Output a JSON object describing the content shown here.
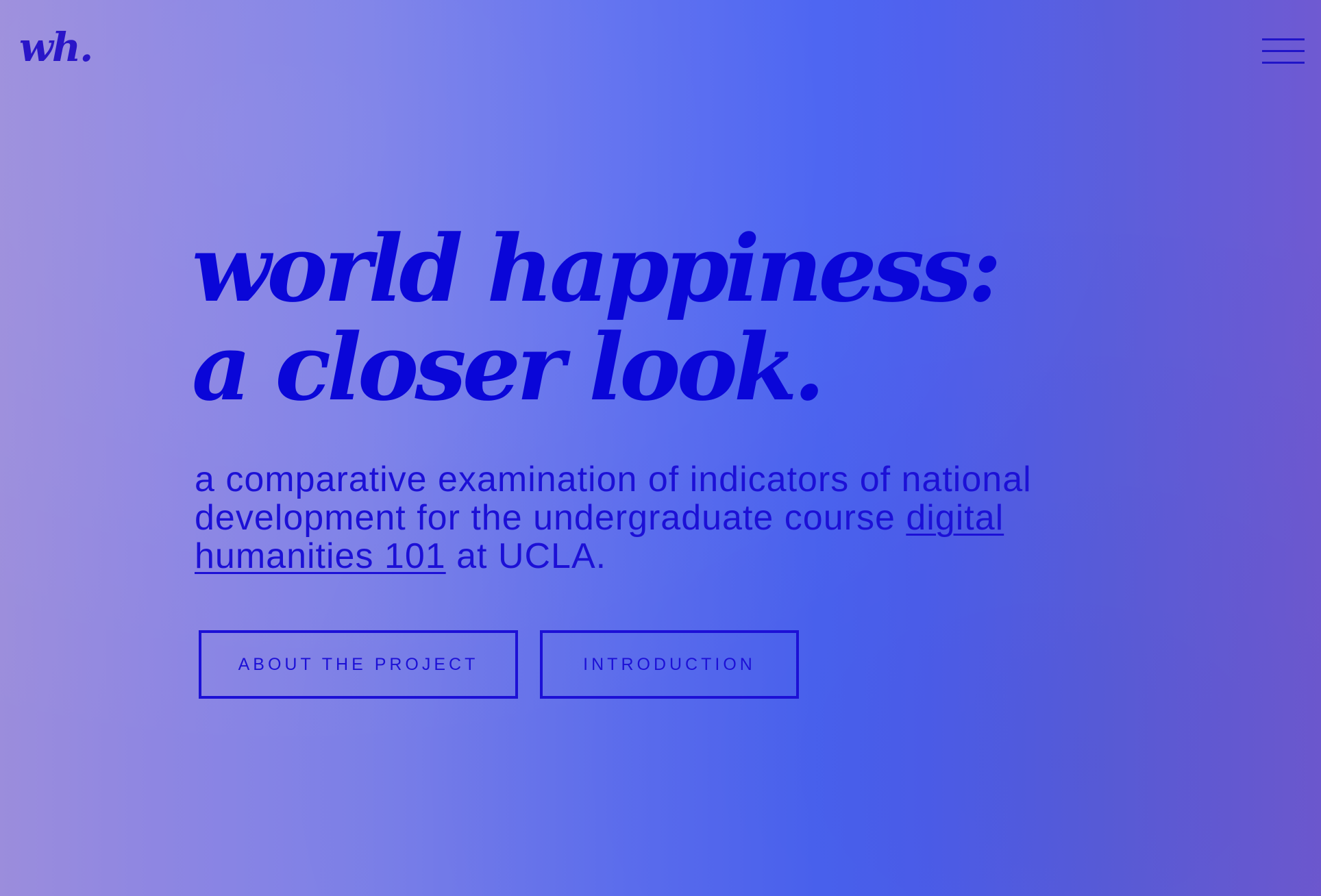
{
  "header": {
    "logo": "wh.",
    "menu_icon": "hamburger-menu-icon"
  },
  "hero": {
    "title_line1": "world happiness:",
    "title_line2": "a closer look.",
    "lead_prefix": "a comparative examination of indicators of national development for the undergraduate course ",
    "lead_link": "digital humanities 101",
    "lead_suffix": " at UCLA."
  },
  "actions": {
    "about_label": "ABOUT THE PROJECT",
    "intro_label": "INTRODUCTION"
  },
  "colors": {
    "text": "#1c10d6",
    "title": "#0a06d8",
    "gradient_start": "#9b8ddc",
    "gradient_mid": "#4a63f2",
    "gradient_end": "#6f5ad2"
  }
}
